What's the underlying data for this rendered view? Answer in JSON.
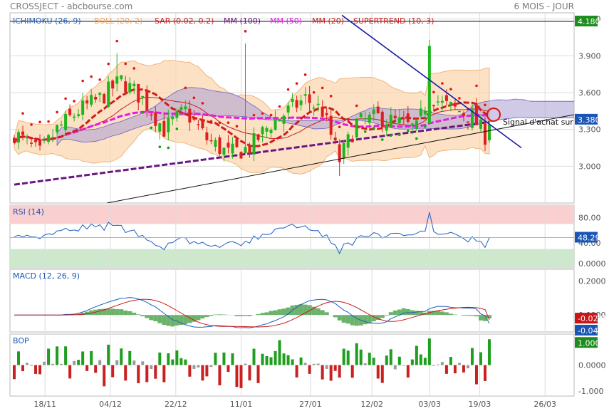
{
  "header": {
    "title": "CROSSJECT - abcbourse.com",
    "period": "6 MOIS - JOUR"
  },
  "colors": {
    "frame": "#b9b9b9",
    "grid": "#dcdcdc",
    "ichimoku_cloud": "#a99fd4",
    "boll_band": "#fbd7b0",
    "boll_mid": "#c11e1e",
    "sar_dots": "#e11717",
    "sar_dots_green": "#14a214",
    "mm100": "#6a1680",
    "mm50": "#e21ce2",
    "mm20": "#d01c1c",
    "up_candle": "#1fb51f",
    "down_candle": "#dd1f1f",
    "rsi_line": "#1d5ebf",
    "rsi_overbought_band": "#f9cfcf",
    "rsi_oversold_band": "#cde8cd",
    "macd_line": "#1d5ebf",
    "signal_line": "#cc1a1a",
    "macd_hist": "#6bb26b",
    "bop_up": "#1f9e1f",
    "bop_down": "#c92020",
    "bop_neutral": "#9a9a9a",
    "trend_line": "#111111",
    "down_trend_line": "#1a1aa5",
    "highlight_circle": "#e01010",
    "price_label_dark": "#0b0b0b",
    "price_label_green": "#1c8c1c",
    "label_blue": "#1b56b5",
    "label_red": "#c81515"
  },
  "chart_data": [
    {
      "type": "candlestick",
      "legend": [
        {
          "label": "ICHIMOKU (26, 9)",
          "color": "#2b62b7"
        },
        {
          "label": "BOLL (20, 2)",
          "color": "#efa55b"
        },
        {
          "label": "SAR (0.02, 0.2)",
          "color": "#c91d1d"
        },
        {
          "label": "MM (100)",
          "color": "#6a1680"
        },
        {
          "label": "MM (50)",
          "color": "#e21ce2"
        },
        {
          "label": "MM (20)",
          "color": "#c91d1d"
        },
        {
          "label": "SUPERTREND (10, 3)",
          "color": "#c91d1d"
        }
      ],
      "y_ticks": [
        "3.000",
        "3.300",
        "3.600",
        "3.900",
        "4.200"
      ],
      "ylim": [
        2.7,
        4.25
      ],
      "last_price": "3.380",
      "resistance_label": "4.180",
      "resistance_value": 4.18,
      "annotation": "Signal d'achat sur",
      "x_ticks": [
        "18/11",
        "04/12",
        "22/12",
        "11/01",
        "27/01",
        "12/02",
        "03/03",
        "19/03",
        "26/03"
      ],
      "candles_count": 112
    },
    {
      "type": "line",
      "name": "RSI (14)",
      "y_ticks": [
        "40.00",
        "80.00"
      ],
      "bottom_tick": "0.0000",
      "ylim": [
        0,
        100
      ],
      "last_value": "48.29",
      "overbought": 70,
      "oversold": 30
    },
    {
      "type": "line",
      "name": "MACD (12, 26, 9)",
      "y_ticks": [
        "0.2000",
        "0.0000"
      ],
      "ylim": [
        -0.1,
        0.27
      ],
      "macd_last": "-0.0494",
      "signal_last": "-0.0290"
    },
    {
      "type": "bar",
      "name": "BOP",
      "y_ticks": [
        "0.0000",
        "-1.000"
      ],
      "ylim": [
        -1.2,
        1.2
      ],
      "last_value": "1.000"
    }
  ]
}
